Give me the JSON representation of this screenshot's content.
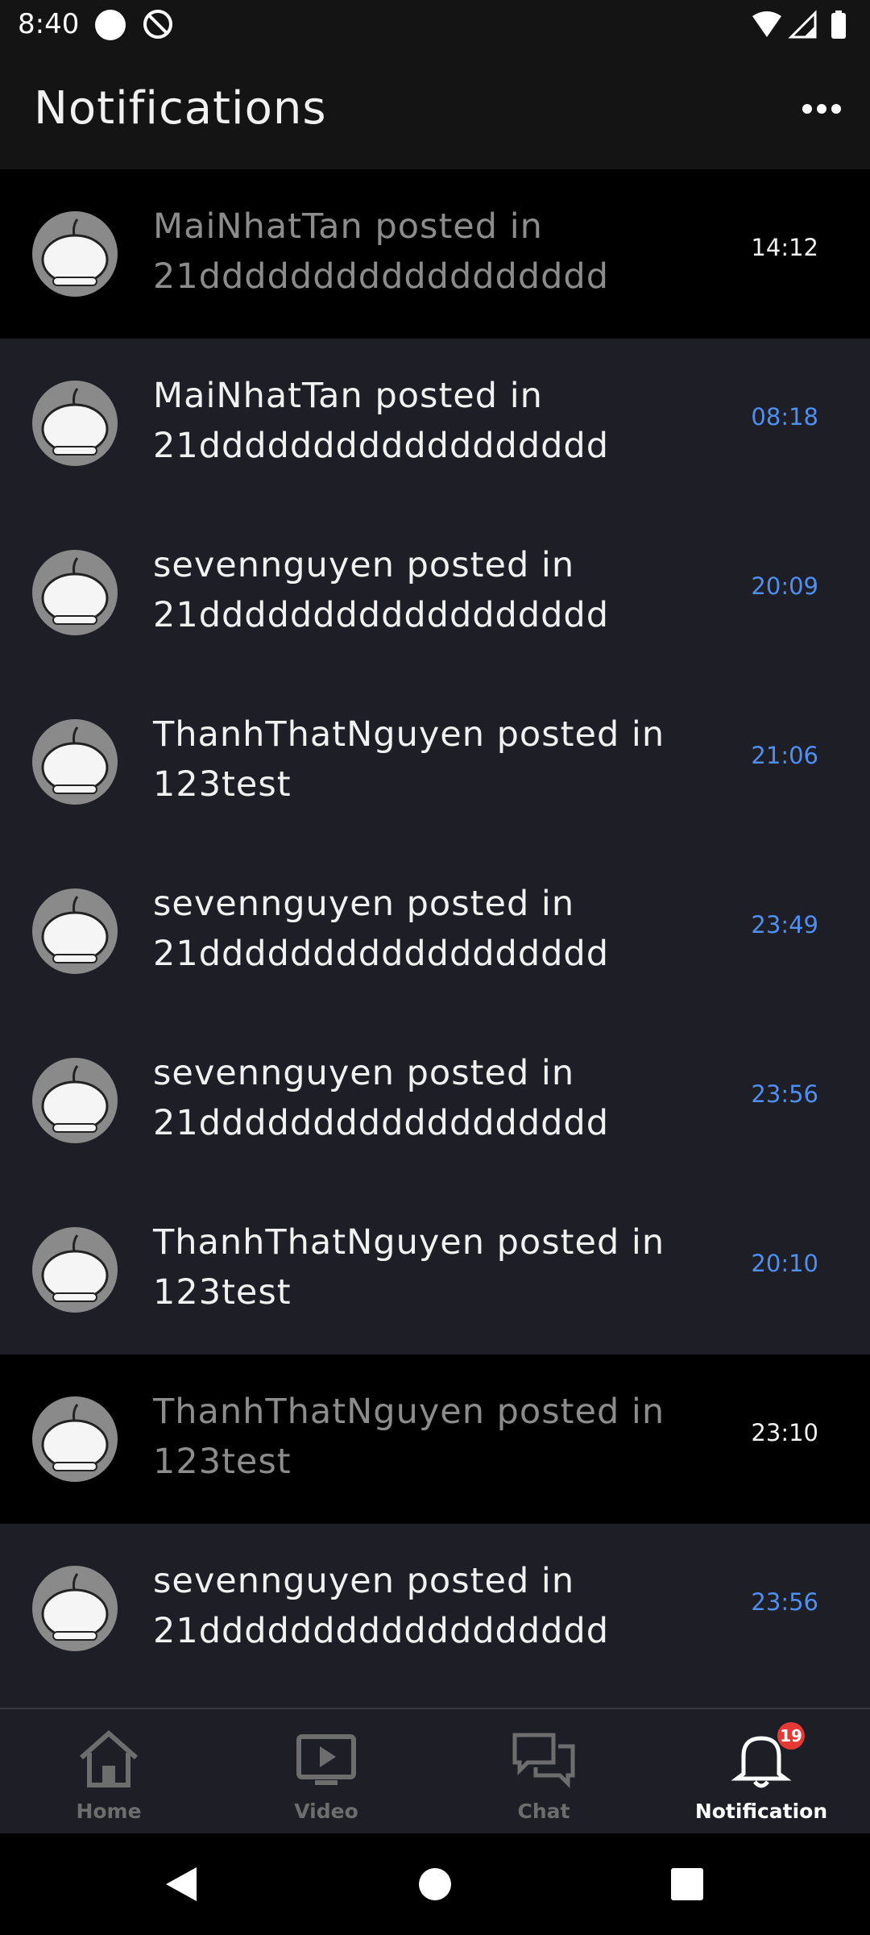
{
  "status_bar": {
    "time": "8:40"
  },
  "header": {
    "title": "Notifications"
  },
  "notifications": [
    {
      "text": "MaiNhatTan posted in 21dddddddddddddddddd",
      "time": "14:12",
      "read": true
    },
    {
      "text": "MaiNhatTan posted in 21dddddddddddddddddd",
      "time": "08:18",
      "read": false
    },
    {
      "text": "sevennguyen posted in 21dddddddddddddddddd",
      "time": "20:09",
      "read": false
    },
    {
      "text": "ThanhThatNguyen posted in 123test",
      "time": "21:06",
      "read": false
    },
    {
      "text": "sevennguyen posted in 21dddddddddddddddddd",
      "time": "23:49",
      "read": false
    },
    {
      "text": "sevennguyen posted in 21dddddddddddddddddd",
      "time": "23:56",
      "read": false
    },
    {
      "text": "ThanhThatNguyen posted in 123test",
      "time": "20:10",
      "read": false
    },
    {
      "text": "ThanhThatNguyen posted in 123test",
      "time": "23:10",
      "read": true
    },
    {
      "text": "sevennguyen posted in 21dddddddddddddddddd",
      "time": "23:56",
      "read": false
    }
  ],
  "bottom_nav": [
    {
      "label": "Home",
      "icon": "home-icon",
      "active": false
    },
    {
      "label": "Video",
      "icon": "video-icon",
      "active": false
    },
    {
      "label": "Chat",
      "icon": "chat-icon",
      "active": false
    },
    {
      "label": "Notification",
      "icon": "bell-icon",
      "active": true,
      "badge": "19"
    }
  ],
  "colors": {
    "unread_time": "#4f8ff0",
    "badge": "#e53935",
    "background": "#1e1e26",
    "read_row": "#000000"
  }
}
